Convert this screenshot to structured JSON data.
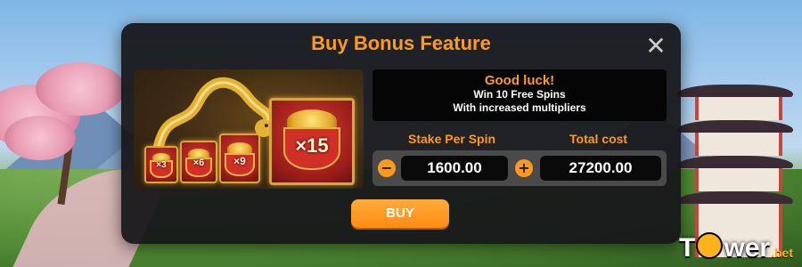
{
  "dialog": {
    "title": "Buy Bonus Feature",
    "close_icon": "close-icon"
  },
  "artwork": {
    "multipliers": [
      "×3",
      "×6",
      "×9",
      "×15"
    ]
  },
  "info": {
    "headline": "Good luck!",
    "line1": "Win 10 Free Spins",
    "line2": "With increased multipliers"
  },
  "stake": {
    "label": "Stake Per Spin",
    "value": "1600.00",
    "decrease_icon": "minus-icon",
    "increase_icon": "plus-icon"
  },
  "total": {
    "label": "Total cost",
    "value": "27200.00"
  },
  "buy_button": {
    "label": "BUY"
  },
  "brand": {
    "name_before_o": "T",
    "name_after_o": "wer",
    "suffix": ".bet"
  },
  "colors": {
    "accent": "#ff9a1f",
    "dialog_bg": "#16161a",
    "field_bg": "#0a0a0a"
  }
}
